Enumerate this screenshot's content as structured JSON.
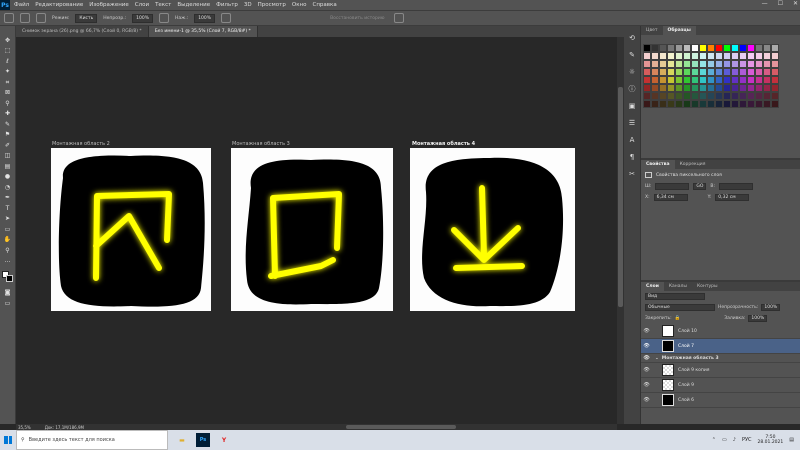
{
  "app": {
    "logo": "Ps"
  },
  "menu": [
    "Файл",
    "Редактирование",
    "Изображение",
    "Слои",
    "Текст",
    "Выделение",
    "Фильтр",
    "3D",
    "Просмотр",
    "Окно",
    "Справка"
  ],
  "window_buttons": [
    "—",
    "☐",
    "✕"
  ],
  "options": {
    "mode_label": "Режим:",
    "mode_value": "Кисть",
    "opacity_label": "Непрозр.:",
    "opacity_value": "100%",
    "pressure_label": "Наж.:",
    "pressure_value": "100%",
    "restore_label": "Восстановить историю"
  },
  "doc_tabs": [
    {
      "label": "Снимок экрана (26).png @ 66,7% (Слой 0, RGB/8) *",
      "active": false
    },
    {
      "label": "Без имени-1 @ 35,5% (Слой 7, RGB/8#) *",
      "active": true
    }
  ],
  "artboards": [
    {
      "label": "Монтажная область 2",
      "glyph": "bookmark-stroke"
    },
    {
      "label": "Монтажная область 3",
      "glyph": "square-stroke"
    },
    {
      "label": "Монтажная область 4",
      "glyph": "download-arrow-stroke"
    }
  ],
  "colors": {
    "glow": "#ffff00",
    "blob": "#000000",
    "artboard_bg": "#ffffff",
    "selected_layer": "#4a6288"
  },
  "status": {
    "zoom": "35,5%",
    "doc": "Док: 17,1M/186,9M"
  },
  "right_panels": {
    "top_tabs": [
      "Цвет",
      "Образцы"
    ],
    "props_tabs": [
      "Свойства",
      "Коррекция"
    ],
    "props_title": "Свойства пиксельного слоя",
    "w_label": "Ш:",
    "w_value": "",
    "h_label": "В:",
    "h_value": "",
    "x_label": "X:",
    "x_value": "6,34 см",
    "y_label": "Y:",
    "y_value": "0,32 см",
    "go_label": "GO",
    "layers_tabs": [
      "Слои",
      "Каналы",
      "Контуры"
    ],
    "search_label": "Вид",
    "blend_mode": "Обычные",
    "opacity_label": "Непрозрачность:",
    "opacity_value": "100%",
    "lock_label": "Закрепить:",
    "fill_label": "Заливка:",
    "fill_value": "100%"
  },
  "layers": [
    {
      "name": "Слой 10",
      "type": "layer",
      "thumb": "white-box",
      "selected": false
    },
    {
      "name": "Слой 7",
      "type": "layer",
      "thumb": "black",
      "selected": true
    },
    {
      "name": "Монтажная область 3",
      "type": "group",
      "thumb": "",
      "selected": false
    },
    {
      "name": "Слой 9 копия",
      "type": "layer",
      "thumb": "checker",
      "selected": false
    },
    {
      "name": "Слой 9",
      "type": "layer",
      "thumb": "checker",
      "selected": false
    },
    {
      "name": "Слой 6",
      "type": "layer",
      "thumb": "black",
      "selected": false
    }
  ],
  "taskbar": {
    "search_placeholder": "Введите здесь текст для поиска",
    "lang": "РУС",
    "time": "7:50",
    "date": "28.01.2021"
  }
}
